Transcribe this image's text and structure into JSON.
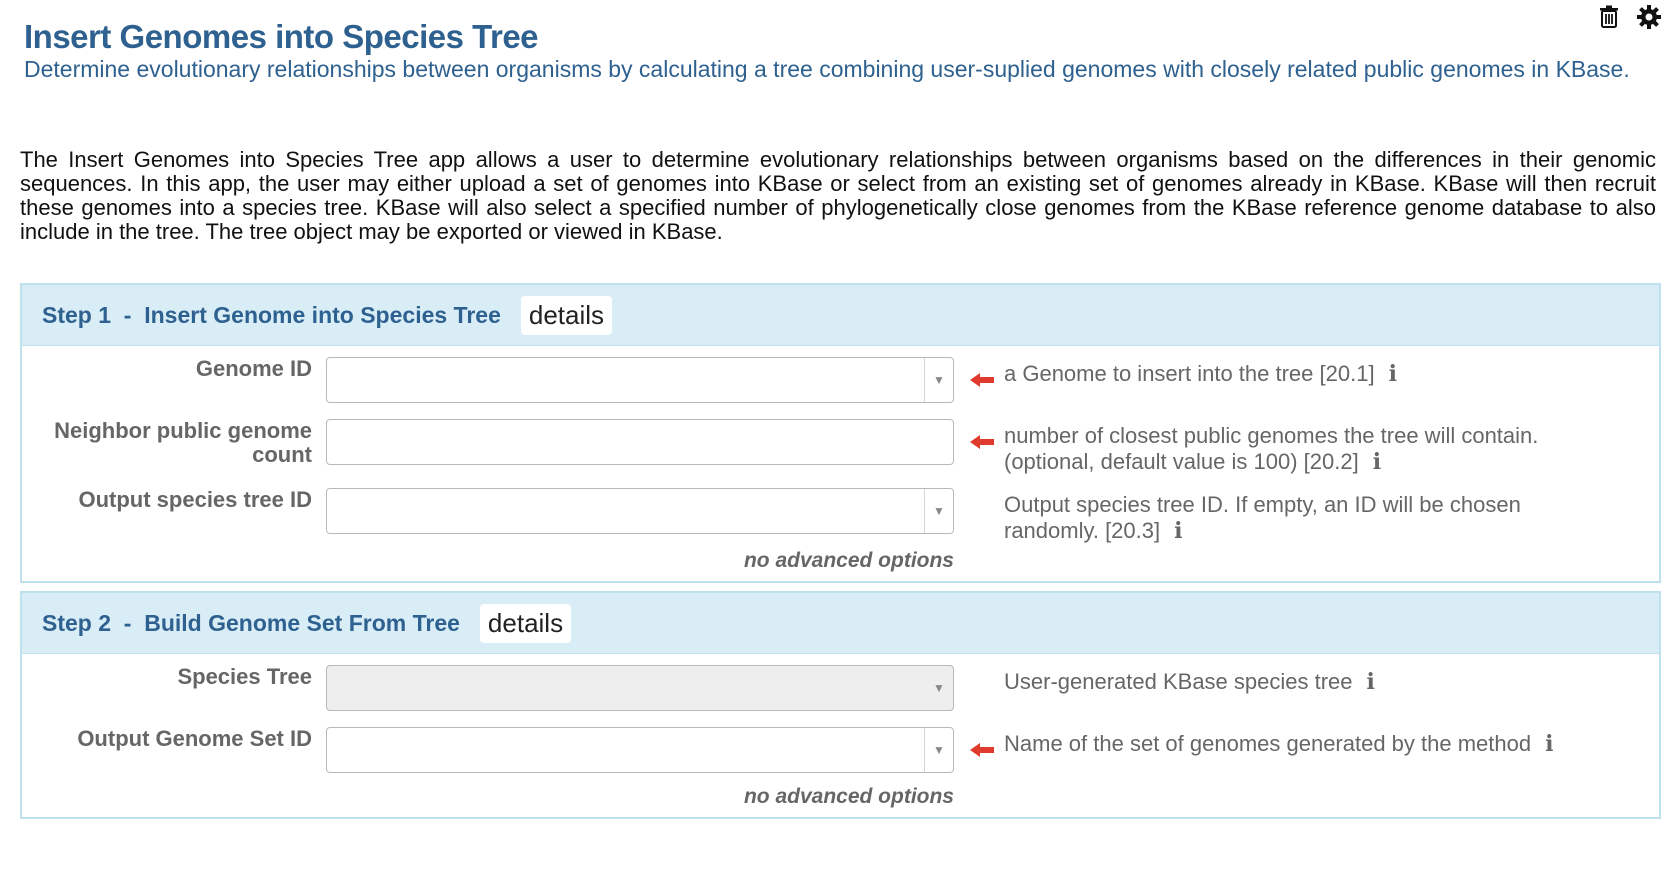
{
  "app": {
    "title": "Insert Genomes into Species Tree",
    "subtitle": "Determine evolutionary relationships between organisms by calculating a tree combining user-suplied genomes with closely related public genomes in KBase.",
    "description": "The Insert Genomes into Species Tree app allows a user to determine evolutionary relationships between organisms based on the differences in their genomic sequences. In this app, the user may either upload a set of genomes into KBase or select from an existing set of genomes already in KBase. KBase will then recruit these genomes into a species tree. KBase will also select a specified number of phylogenetically close genomes from the KBase reference genome database to also include in the tree. The tree object may be exported or viewed in KBase."
  },
  "toolbar": {
    "icons": [
      "trash-icon",
      "gear-icon"
    ]
  },
  "steps": [
    {
      "title": "Step 1  -  Insert Genome into Species Tree",
      "details_label": "details",
      "fields": [
        {
          "label": "Genome ID",
          "value": "",
          "type": "select",
          "hint": "a Genome to insert into the tree [20.1]"
        },
        {
          "label": "Neighbor public genome count",
          "value": "",
          "type": "text",
          "hint": "number of closest public genomes the tree will contain. (optional, default value is 100) [20.2]"
        },
        {
          "label": "Output species tree ID",
          "value": "",
          "type": "select",
          "hint": "Output species tree ID. If empty, an ID will be chosen randomly. [20.3]"
        }
      ],
      "advanced": "no advanced options"
    },
    {
      "title": "Step 2  -  Build Genome Set From Tree",
      "details_label": "details",
      "fields": [
        {
          "label": "Species Tree",
          "value": "",
          "type": "select-disabled",
          "hint": "User-generated KBase species tree"
        },
        {
          "label": "Output Genome Set ID",
          "value": "",
          "type": "select",
          "hint": "Name of the set of genomes generated by the method"
        }
      ],
      "advanced": "no advanced options"
    }
  ],
  "info_glyph": "i",
  "colors": {
    "accent": "#2e618f",
    "step_header_bg": "#d9edf7",
    "required_arrow": "#e03a2f"
  }
}
